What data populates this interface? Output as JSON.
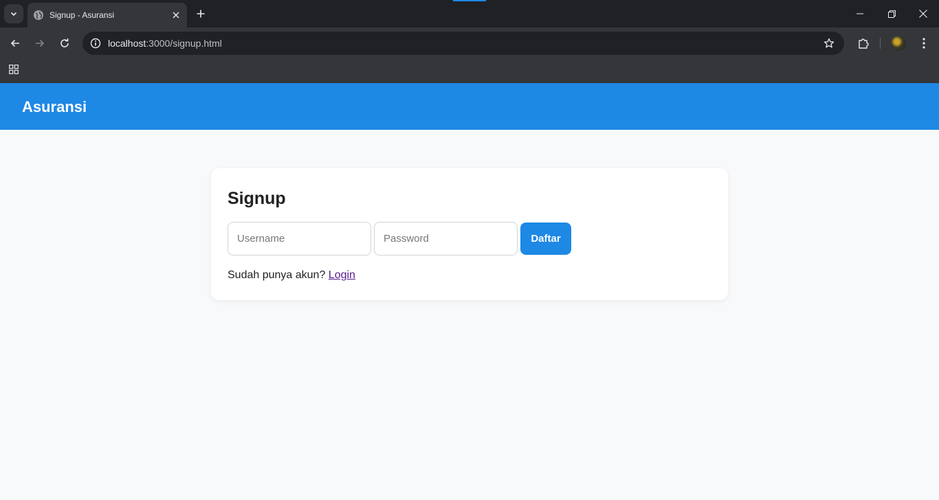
{
  "browser": {
    "tab": {
      "title": "Signup - Asuransi"
    },
    "address": {
      "host": "localhost",
      "path": ":3000/signup.html"
    },
    "icons": {
      "tab_list": "chevron-down-icon",
      "favicon": "globe-icon",
      "tab_close": "close-icon",
      "new_tab": "plus-icon",
      "minimize": "minimize-icon",
      "restore": "restore-icon",
      "close_window": "close-icon",
      "back": "arrow-left-icon",
      "forward": "arrow-right-icon",
      "reload": "reload-icon",
      "site_info": "info-icon",
      "bookmark": "star-icon",
      "extensions": "puzzle-icon",
      "menu": "kebab-menu-icon",
      "apps": "apps-grid-icon"
    }
  },
  "app": {
    "brand": "Asuransi",
    "colors": {
      "primary": "#1e88e5",
      "background": "#f8f9fb"
    }
  },
  "signup": {
    "title": "Signup",
    "username": {
      "placeholder": "Username",
      "value": ""
    },
    "password": {
      "placeholder": "Password",
      "value": ""
    },
    "submit_label": "Daftar",
    "login_prompt": "Sudah punya akun?",
    "login_link": "Login"
  }
}
